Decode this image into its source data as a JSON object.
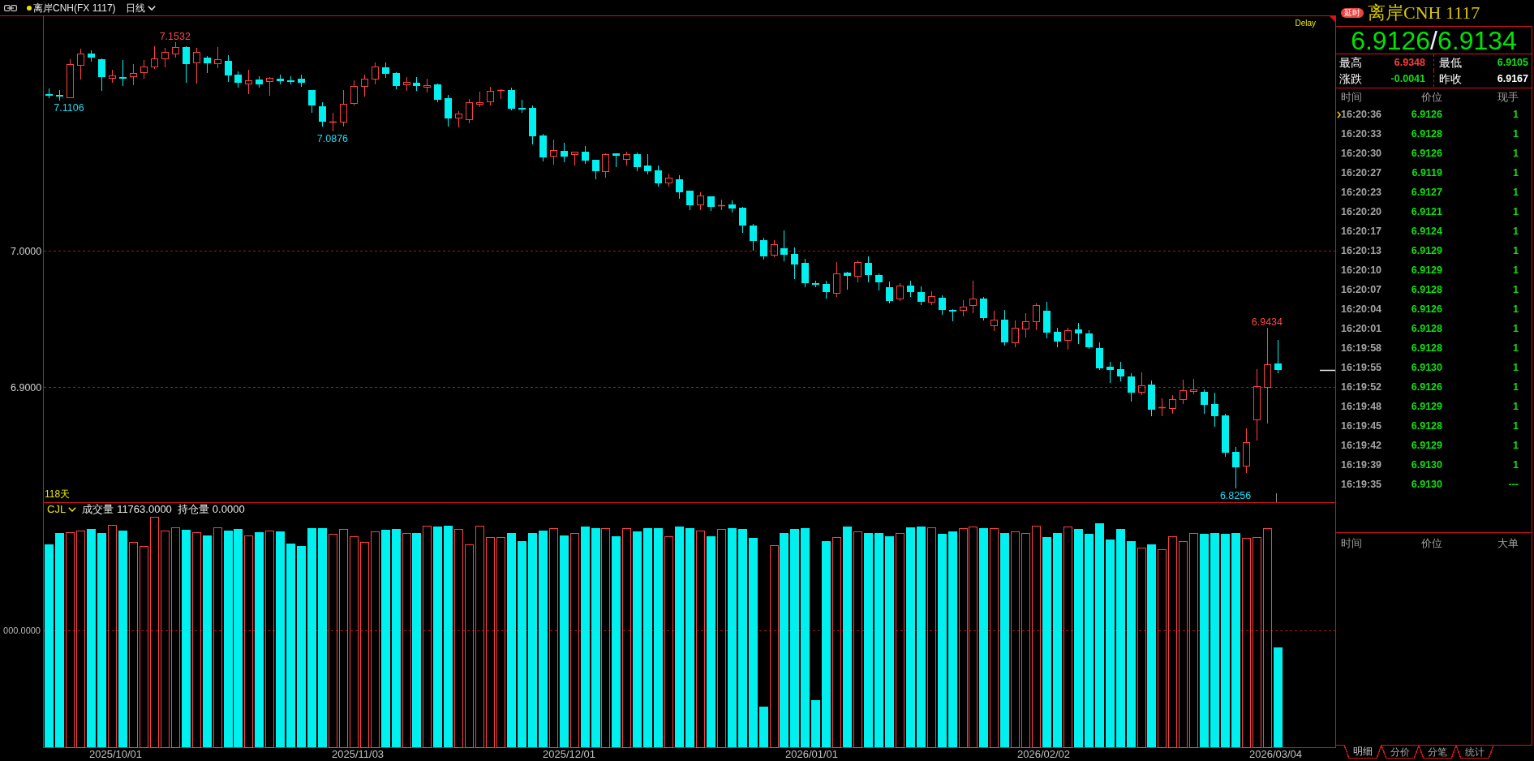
{
  "toolbar": {
    "symbol": "离岸CNH(FX 1117)",
    "period": "日线"
  },
  "price_chart": {
    "status": "Delay",
    "span_label": "118天",
    "chart_data": {
      "type": "candlestick",
      "categories": [
        null,
        null,
        null,
        null,
        null,
        null,
        null,
        null,
        null,
        null,
        null,
        null,
        null,
        null,
        null,
        null,
        null,
        null,
        null,
        null,
        null,
        null,
        null,
        null,
        null,
        null,
        null,
        null,
        null,
        null,
        null,
        null,
        null,
        null,
        null,
        null,
        null,
        null,
        null,
        null,
        null,
        null,
        null,
        null,
        null,
        null,
        null,
        null,
        null,
        null,
        null,
        null,
        null,
        null,
        null,
        null,
        null,
        null,
        null,
        null,
        null,
        null,
        null,
        null,
        null,
        null,
        null,
        null,
        null,
        null,
        null,
        null,
        null,
        null,
        null,
        null,
        null,
        null,
        null,
        null,
        null,
        null,
        null,
        null,
        null,
        null,
        null,
        null,
        null,
        null,
        null,
        null,
        null,
        null,
        null,
        null,
        null,
        null,
        null,
        null,
        null,
        null,
        null,
        null,
        null,
        null,
        null,
        null,
        null,
        null,
        null,
        null,
        null,
        null,
        null,
        null,
        null,
        null,
        null,
        null,
        null,
        null,
        null
      ],
      "ohlc": [
        [
          7.1153,
          7.1194,
          7.1123,
          7.1144
        ],
        [
          7.1147,
          7.1182,
          7.1106,
          7.1135
        ],
        [
          7.1129,
          7.1406,
          7.1126,
          7.1371
        ],
        [
          7.1365,
          7.1483,
          7.1259,
          7.1447
        ],
        [
          7.1447,
          7.1471,
          7.1388,
          7.1418
        ],
        [
          7.1406,
          7.1412,
          7.1176,
          7.1277
        ],
        [
          7.1271,
          7.133,
          7.1235,
          7.1288
        ],
        [
          7.1277,
          7.14,
          7.1212,
          7.1271
        ],
        [
          7.1282,
          7.1371,
          7.1218,
          7.1306
        ],
        [
          7.1312,
          7.14,
          7.1265,
          7.1353
        ],
        [
          7.1353,
          7.15,
          7.1335,
          7.1412
        ],
        [
          7.1412,
          7.1489,
          7.1347,
          7.1459
        ],
        [
          7.1447,
          7.1532,
          7.1418,
          7.1494
        ],
        [
          7.1494,
          7.15,
          7.1235,
          7.1371
        ],
        [
          7.1383,
          7.1489,
          7.1229,
          7.1459
        ],
        [
          7.1418,
          7.143,
          7.1306,
          7.1377
        ],
        [
          7.1377,
          7.1494,
          7.1341,
          7.1406
        ],
        [
          7.1394,
          7.1436,
          7.1241,
          7.1288
        ],
        [
          7.1294,
          7.1318,
          7.12,
          7.1235
        ],
        [
          7.1229,
          7.133,
          7.1153,
          7.1253
        ],
        [
          7.1259,
          7.1282,
          7.12,
          7.1224
        ],
        [
          7.1247,
          7.1277,
          7.1141,
          7.1271
        ],
        [
          7.1265,
          7.1294,
          7.1224,
          7.1247
        ],
        [
          7.1253,
          7.1282,
          7.1224,
          7.1247
        ],
        [
          7.1265,
          7.1294,
          7.1206,
          7.1235
        ],
        [
          7.1182,
          7.1182,
          7.1017,
          7.107
        ],
        [
          7.1065,
          7.1094,
          7.0911,
          7.0947
        ],
        [
          7.0941,
          7.1012,
          7.0876,
          7.0947
        ],
        [
          7.0947,
          7.1182,
          7.0911,
          7.1082
        ],
        [
          7.1088,
          7.1253,
          7.107,
          7.1212
        ],
        [
          7.1212,
          7.1294,
          7.1135,
          7.1265
        ],
        [
          7.1265,
          7.1383,
          7.1224,
          7.1353
        ],
        [
          7.1347,
          7.1383,
          7.1271,
          7.13
        ],
        [
          7.1306,
          7.1312,
          7.1188,
          7.1212
        ],
        [
          7.1224,
          7.1277,
          7.1176,
          7.1241
        ],
        [
          7.1235,
          7.1277,
          7.1176,
          7.1212
        ],
        [
          7.1206,
          7.1265,
          7.1165,
          7.1218
        ],
        [
          7.1224,
          7.1229,
          7.1094,
          7.1112
        ],
        [
          7.1123,
          7.1147,
          7.0911,
          7.097
        ],
        [
          7.0976,
          7.1029,
          7.0906,
          7.1006
        ],
        [
          7.0964,
          7.1118,
          7.0935,
          7.1094
        ],
        [
          7.1082,
          7.1171,
          7.1059,
          7.1094
        ],
        [
          7.1095,
          7.1205,
          7.1071,
          7.1177
        ],
        [
          7.118,
          7.1187,
          7.1118,
          7.1182
        ],
        [
          7.118,
          7.1199,
          7.1035,
          7.1045
        ],
        [
          7.105,
          7.1107,
          7.1015,
          7.1038
        ],
        [
          7.105,
          7.1068,
          7.0785,
          7.0843
        ],
        [
          7.085,
          7.086,
          7.0659,
          7.0689
        ],
        [
          7.0698,
          7.082,
          7.0636,
          7.074
        ],
        [
          7.0735,
          7.0793,
          7.0652,
          7.0694
        ],
        [
          7.071,
          7.0728,
          7.063,
          7.0728
        ],
        [
          7.0728,
          7.0769,
          7.0641,
          7.0664
        ],
        [
          7.0671,
          7.0671,
          7.0527,
          7.0588
        ],
        [
          7.0588,
          7.0717,
          7.054,
          7.071
        ],
        [
          7.0715,
          7.0715,
          7.0618,
          7.07
        ],
        [
          7.0678,
          7.0728,
          7.063,
          7.071
        ],
        [
          7.0712,
          7.0721,
          7.0586,
          7.0618
        ],
        [
          7.0625,
          7.071,
          7.0563,
          7.0588
        ],
        [
          7.0593,
          7.063,
          7.0475,
          7.0499
        ],
        [
          7.0503,
          7.0568,
          7.0475,
          7.0538
        ],
        [
          7.0527,
          7.0554,
          7.0384,
          7.0434
        ],
        [
          7.0441,
          7.0441,
          7.0301,
          7.0333
        ],
        [
          7.034,
          7.0434,
          7.0301,
          7.0405
        ],
        [
          7.0402,
          7.0402,
          7.0297,
          7.0324
        ],
        [
          7.0331,
          7.0375,
          7.0301,
          7.0333
        ],
        [
          7.0343,
          7.0372,
          7.0283,
          7.0315
        ],
        [
          7.0319,
          7.0324,
          7.0131,
          7.0188
        ],
        [
          7.0188,
          7.0198,
          7.0,
          7.0074
        ],
        [
          7.0081,
          7.0097,
          6.9936,
          6.9963
        ],
        [
          6.9971,
          7.0081,
          6.9955,
          7.0051
        ],
        [
          7.0021,
          7.015,
          6.9925,
          6.9971
        ],
        [
          6.9978,
          7.0028,
          6.9796,
          6.9902
        ],
        [
          6.9913,
          6.9941,
          6.9737,
          6.9762
        ],
        [
          6.9764,
          6.978,
          6.9732,
          6.976
        ],
        [
          6.9759,
          6.978,
          6.9649,
          6.97
        ],
        [
          6.9695,
          6.992,
          6.9665,
          6.9837
        ],
        [
          6.9842,
          6.9849,
          6.9718,
          6.9815
        ],
        [
          6.9817,
          6.9931,
          6.9773,
          6.9922
        ],
        [
          6.9913,
          6.9959,
          6.9773,
          6.9826
        ],
        [
          6.9824,
          6.9833,
          6.9713,
          6.9769
        ],
        [
          6.9734,
          6.9775,
          6.9617,
          6.9633
        ],
        [
          6.9649,
          6.9764,
          6.9631,
          6.9746
        ],
        [
          6.9744,
          6.9783,
          6.9663,
          6.9699
        ],
        [
          6.9699,
          6.9741,
          6.9604,
          6.963
        ],
        [
          6.963,
          6.9705,
          6.9604,
          6.9669
        ],
        [
          6.9658,
          6.9675,
          6.9532,
          6.957
        ],
        [
          6.957,
          6.9574,
          6.9485,
          6.9568
        ],
        [
          6.9568,
          6.9637,
          6.9522,
          6.9592
        ],
        [
          6.9601,
          6.9783,
          6.9544,
          6.9651
        ],
        [
          6.9651,
          6.9665,
          6.9491,
          6.951
        ],
        [
          6.9452,
          6.9562,
          6.9413,
          6.9497
        ],
        [
          6.9497,
          6.9568,
          6.9307,
          6.933
        ],
        [
          6.9332,
          6.9491,
          6.9294,
          6.9437
        ],
        [
          6.9433,
          6.9544,
          6.9367,
          6.9485
        ],
        [
          6.9485,
          6.9616,
          6.9419,
          6.9604
        ],
        [
          6.9562,
          6.9628,
          6.9361,
          6.9401
        ],
        [
          6.9407,
          6.9437,
          6.9294,
          6.9336
        ],
        [
          6.9345,
          6.9437,
          6.9276,
          6.9419
        ],
        [
          6.9425,
          6.9473,
          6.9318,
          6.9395
        ],
        [
          6.9395,
          6.9419,
          6.9282,
          6.9294
        ],
        [
          6.9288,
          6.933,
          6.9127,
          6.9139
        ],
        [
          6.9151,
          6.9187,
          6.9035,
          6.9127
        ],
        [
          6.9133,
          6.9187,
          6.9044,
          6.908
        ],
        [
          6.908,
          6.9104,
          6.8895,
          6.8962
        ],
        [
          6.8967,
          6.911,
          6.8943,
          6.9014
        ],
        [
          6.902,
          6.905,
          6.8788,
          6.8838
        ],
        [
          6.8848,
          6.8921,
          6.8788,
          6.8851
        ],
        [
          6.8848,
          6.8943,
          6.8806,
          6.8913
        ],
        [
          6.8913,
          6.9056,
          6.8877,
          6.8979
        ],
        [
          6.8973,
          6.9062,
          6.8949,
          6.8985
        ],
        [
          6.8967,
          6.8985,
          6.8806,
          6.8871
        ],
        [
          6.8877,
          6.8961,
          6.8711,
          6.8788
        ],
        [
          6.8794,
          6.8806,
          6.8491,
          6.852
        ],
        [
          6.8526,
          6.8562,
          6.8256,
          6.8413
        ],
        [
          6.8425,
          6.8699,
          6.8371,
          6.8598
        ],
        [
          6.8764,
          6.9133,
          6.861,
          6.9008
        ],
        [
          6.9002,
          6.9434,
          6.8735,
          6.9167
        ],
        [
          6.9175,
          6.9348,
          6.9105,
          6.9126
        ],
        null,
        null,
        null,
        null,
        null
      ],
      "ylim": [
        6.8157,
        7.1723
      ],
      "yticks": [
        {
          "value": 7.0,
          "label": "7.0000"
        },
        {
          "value": 6.9,
          "label": "6.9000"
        }
      ],
      "annotations": [
        "7.1532",
        "7.1106",
        "7.0876",
        "6.9434",
        "6.8256"
      ]
    }
  },
  "volume_chart": {
    "indicator": "CJL",
    "readouts": [
      {
        "label": "成交量",
        "value": "11763.0000"
      },
      {
        "label": "持仓量",
        "value": "0.0000"
      }
    ],
    "axis_ticks": [
      "000.0000"
    ]
  },
  "date_axis": [
    "2025/10/01",
    "2025/11/03",
    "2025/12/01",
    "2026/01/01",
    "2026/02/02",
    "2026/03/04"
  ],
  "quote_panel": {
    "badge": "延时",
    "title": "离岸CNH 1117",
    "bid": "6.9126",
    "separator": "/",
    "ask": "6.9134",
    "stats": [
      {
        "label": "最高",
        "value": "6.9348",
        "color": "#ff3c3c"
      },
      {
        "label": "最低",
        "value": "6.9105",
        "color": "#10e010"
      },
      {
        "label": "涨跌",
        "value": "-0.0041",
        "color": "#10e010"
      },
      {
        "label": "昨收",
        "value": "6.9167",
        "color": "#ffffff"
      }
    ]
  },
  "trades": {
    "columns": [
      "时间",
      "价位",
      "现手"
    ],
    "rows": [
      {
        "time": "16:20:36",
        "price": "6.9126",
        "volume": "1",
        "selected": true
      },
      {
        "time": "16:20:33",
        "price": "6.9128",
        "volume": "1",
        "selected": false
      },
      {
        "time": "16:20:30",
        "price": "6.9126",
        "volume": "1",
        "selected": false
      },
      {
        "time": "16:20:27",
        "price": "6.9119",
        "volume": "1",
        "selected": false
      },
      {
        "time": "16:20:23",
        "price": "6.9127",
        "volume": "1",
        "selected": false
      },
      {
        "time": "16:20:20",
        "price": "6.9121",
        "volume": "1",
        "selected": false
      },
      {
        "time": "16:20:17",
        "price": "6.9124",
        "volume": "1",
        "selected": false
      },
      {
        "time": "16:20:13",
        "price": "6.9129",
        "volume": "1",
        "selected": false
      },
      {
        "time": "16:20:10",
        "price": "6.9129",
        "volume": "1",
        "selected": false
      },
      {
        "time": "16:20:07",
        "price": "6.9128",
        "volume": "1",
        "selected": false
      },
      {
        "time": "16:20:04",
        "price": "6.9126",
        "volume": "1",
        "selected": false
      },
      {
        "time": "16:20:01",
        "price": "6.9128",
        "volume": "1",
        "selected": false
      },
      {
        "time": "16:19:58",
        "price": "6.9128",
        "volume": "1",
        "selected": false
      },
      {
        "time": "16:19:55",
        "price": "6.9130",
        "volume": "1",
        "selected": false
      },
      {
        "time": "16:19:52",
        "price": "6.9126",
        "volume": "1",
        "selected": false
      },
      {
        "time": "16:19:48",
        "price": "6.9129",
        "volume": "1",
        "selected": false
      },
      {
        "time": "16:19:45",
        "price": "6.9128",
        "volume": "1",
        "selected": false
      },
      {
        "time": "16:19:42",
        "price": "6.9129",
        "volume": "1",
        "selected": false
      },
      {
        "time": "16:19:39",
        "price": "6.9130",
        "volume": "1",
        "selected": false
      },
      {
        "time": "16:19:35",
        "price": "6.9130",
        "volume": "---",
        "selected": false
      }
    ]
  },
  "large_orders": {
    "columns": [
      "时间",
      "价位",
      "大单"
    ]
  },
  "tabs": [
    {
      "label": "明细",
      "selected": true
    },
    {
      "label": "分价",
      "selected": false
    },
    {
      "label": "分笔",
      "selected": false
    },
    {
      "label": "统计",
      "selected": false
    }
  ]
}
